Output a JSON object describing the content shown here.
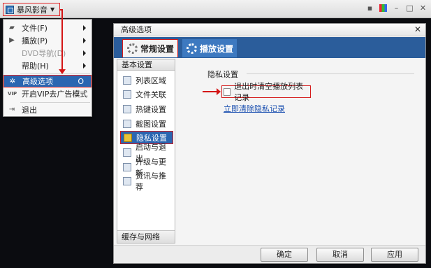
{
  "player": {
    "logo_label": "暴风影音"
  },
  "menu": {
    "items": [
      {
        "label": "文件(F)"
      },
      {
        "label": "播放(P)"
      },
      {
        "label": "DVD导航(D)"
      },
      {
        "label": "帮助(H)"
      },
      {
        "label": "高级选项",
        "shortcut": "O"
      },
      {
        "label": "开启VIP去广告模式"
      },
      {
        "label": "退出"
      }
    ]
  },
  "dialog": {
    "title": "高级选项",
    "tabs": [
      {
        "label": "常规设置"
      },
      {
        "label": "播放设置"
      }
    ],
    "sidebar": {
      "header": "基本设置",
      "items": [
        {
          "label": "列表区域"
        },
        {
          "label": "文件关联"
        },
        {
          "label": "热键设置"
        },
        {
          "label": "截图设置"
        },
        {
          "label": "隐私设置"
        },
        {
          "label": "启动与退出"
        },
        {
          "label": "升级与更新"
        },
        {
          "label": "资讯与推荐"
        }
      ],
      "footer": "缓存与网络"
    },
    "content": {
      "section_title": "隐私设置",
      "checkbox_label": "退出时清空播放列表记录",
      "clear_link": "立即清除隐私记录"
    },
    "buttons": {
      "ok": "确定",
      "cancel": "取消",
      "apply": "应用"
    }
  },
  "colors": {
    "accent": "#2a66b1",
    "highlight_border": "#d51b1b"
  }
}
